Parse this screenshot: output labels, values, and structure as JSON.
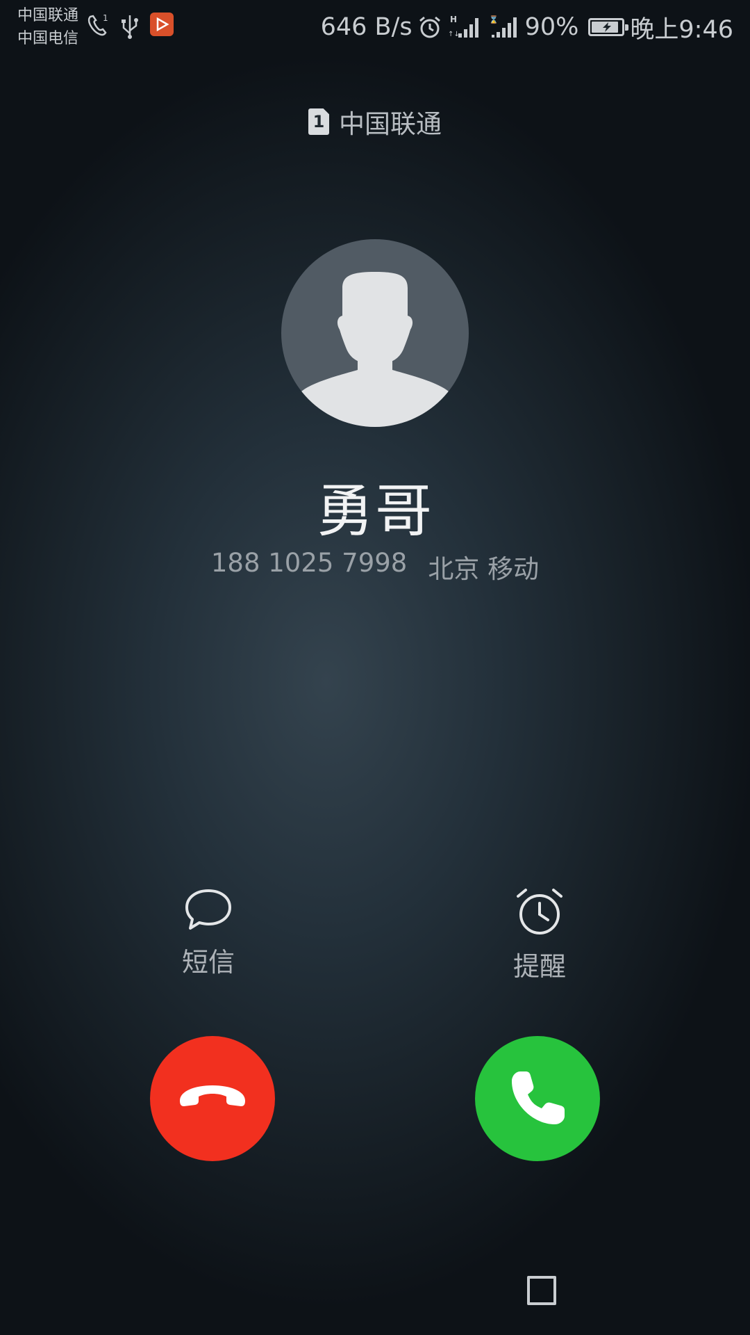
{
  "status_bar": {
    "carrier_1": "中国联通",
    "carrier_2": "中国电信",
    "network_speed": "646 B/s",
    "battery_percent": "90%",
    "battery_level": 0.9,
    "time": "晚上9:46",
    "icons": [
      "phone-call-icon",
      "usb-icon",
      "app-notification-icon",
      "alarm-icon",
      "signal-h-icon",
      "signal-bars-icon",
      "signal-icon",
      "battery-icon"
    ]
  },
  "sim": {
    "slot": "1",
    "carrier": "中国联通"
  },
  "caller": {
    "name": "勇哥",
    "number": "188 1025 7998",
    "location": "北京 移动",
    "avatar_icon": "default-person-avatar"
  },
  "actions": {
    "message_label": "短信",
    "message_icon": "chat-bubble-icon",
    "remind_label": "提醒",
    "remind_icon": "alarm-clock-icon"
  },
  "buttons": {
    "decline_icon": "hang-up-icon",
    "decline_color": "#f2301f",
    "answer_icon": "phone-answer-icon",
    "answer_color": "#27c33d"
  },
  "nav": {
    "recents_icon": "square-recents-icon"
  }
}
